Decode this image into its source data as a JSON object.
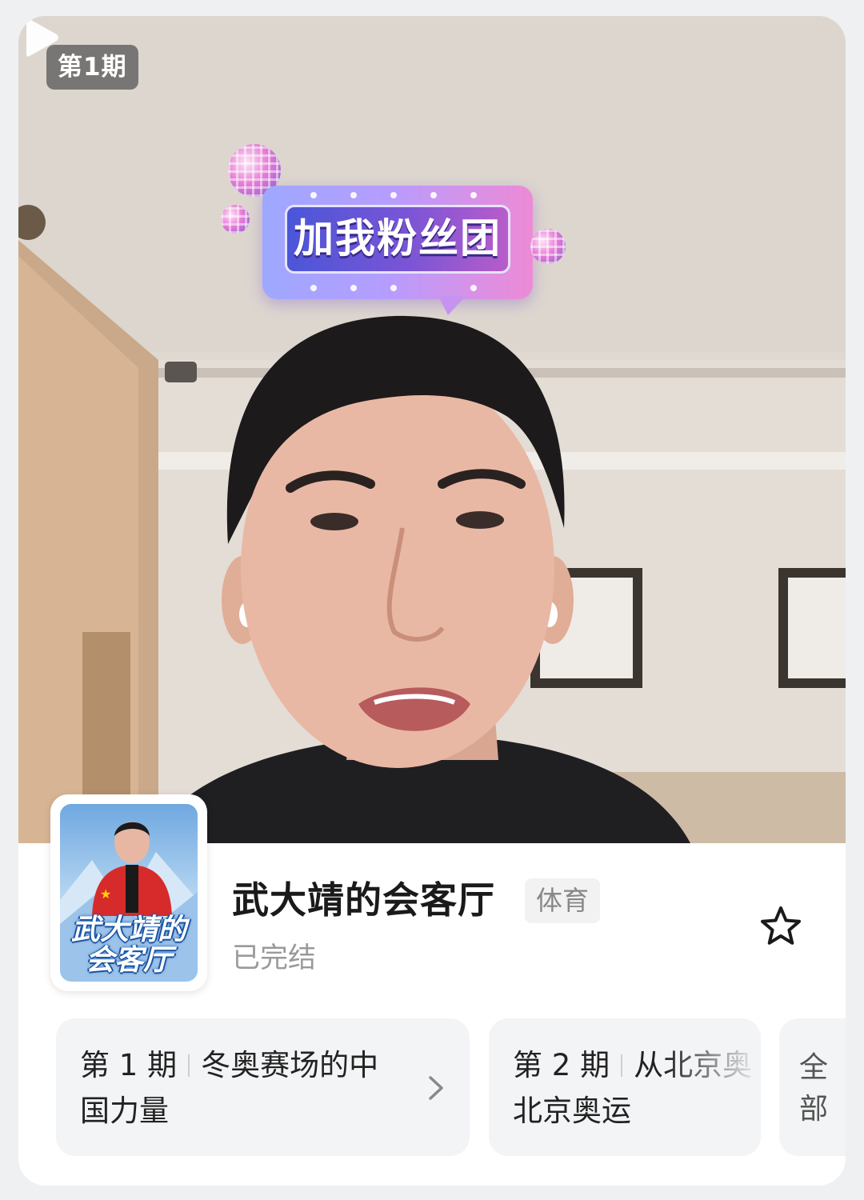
{
  "video": {
    "episode_badge": "第1期",
    "sticker_text": "加我粉丝团"
  },
  "show": {
    "cover_line1": "武大靖的",
    "cover_line2": "会客厅",
    "title": "武大靖的会客厅",
    "genre": "体育",
    "status": "已完结"
  },
  "episodes": [
    {
      "num": "第 1 期",
      "title_line1": "冬奥赛场的中",
      "title_line2": "国力量"
    },
    {
      "num": "第 2 期",
      "title_line1": "从北京奥",
      "title_line2": "北京奥运"
    }
  ],
  "all_label_line1": "全",
  "all_label_line2": "部",
  "icons": {
    "play": "play-icon",
    "favorite": "star-outline-icon",
    "chevron": "chevron-right-icon"
  },
  "colors": {
    "card_bg": "#ffffff",
    "episode_bg": "#f3f4f6",
    "title_text": "#1a1a1a",
    "muted_text": "#9a9a9a"
  }
}
